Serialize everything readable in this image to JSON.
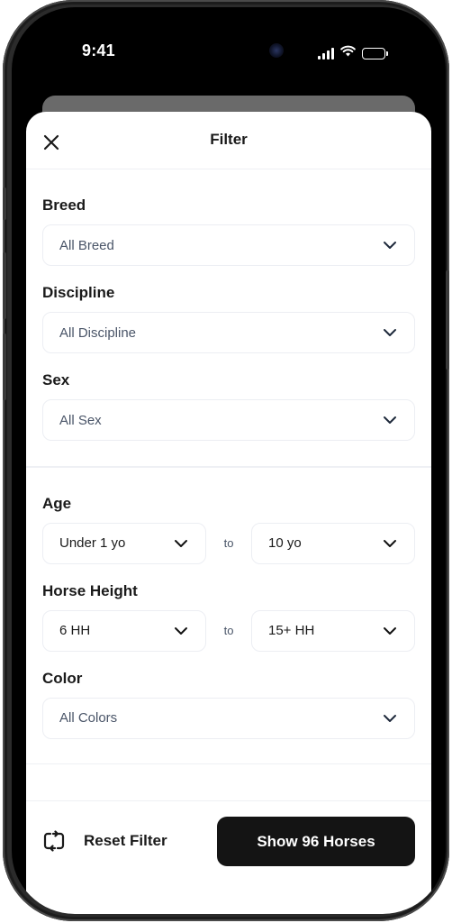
{
  "status_bar": {
    "time": "9:41",
    "icons": [
      "signal-icon",
      "wifi-icon",
      "battery-icon"
    ]
  },
  "sheet": {
    "title": "Filter",
    "close_icon": "close-icon"
  },
  "filters": {
    "breed": {
      "label": "Breed",
      "value": "All Breed"
    },
    "discipline": {
      "label": "Discipline",
      "value": "All Discipline"
    },
    "sex": {
      "label": "Sex",
      "value": "All Sex"
    },
    "age": {
      "label": "Age",
      "from": "Under 1 yo",
      "separator": "to",
      "to": "10 yo"
    },
    "height": {
      "label": "Horse Height",
      "from": "6 HH",
      "separator": "to",
      "to": "15+ HH"
    },
    "color": {
      "label": "Color",
      "value": "All Colors"
    }
  },
  "footer": {
    "reset_label": "Reset Filter",
    "reset_icon": "repeat-icon",
    "show_label": "Show 96 Horses",
    "result_count": 96
  },
  "colors": {
    "primary_button": "#141414",
    "placeholder_text": "#4a5568",
    "border": "#eceef3"
  }
}
